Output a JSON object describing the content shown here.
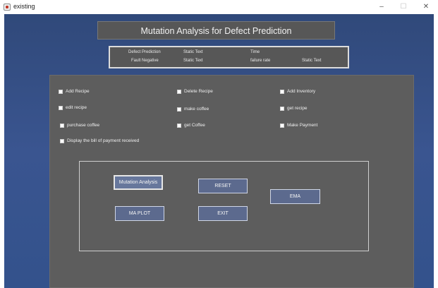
{
  "window": {
    "title": "existing",
    "controls": {
      "minimize": "–",
      "maximize": "☐",
      "close": "✕"
    }
  },
  "header": {
    "title": "Mutation Analysis  for Defect Prediction"
  },
  "info": {
    "row1": {
      "col1": "Defect Prediction",
      "col2": "Static Text",
      "col3": "Time"
    },
    "row2": {
      "col1": "Fault Negative",
      "col2": "Static Text",
      "col3": "failure rate",
      "col4": "Static Text"
    }
  },
  "checkboxes": {
    "add_recipe": "Add Recipe",
    "delete_recipe": "Delete Recipe",
    "add_inventory": "Add Inventory",
    "edit_recipe": "edit recipe",
    "make_coffee": "make coffee",
    "get_recipe": "get recipe",
    "purchase_coffee": "purchase coffee",
    "get_coffee": "get Coffee",
    "make_payment": "Make Payment",
    "display_bill": "Display the bill of payment received"
  },
  "buttons": {
    "mutation_analysis": "Mutation Analysis",
    "reset": "RESET",
    "ema": "EMA",
    "ma_plot": "MA PLOT",
    "exit": "EXIT"
  }
}
